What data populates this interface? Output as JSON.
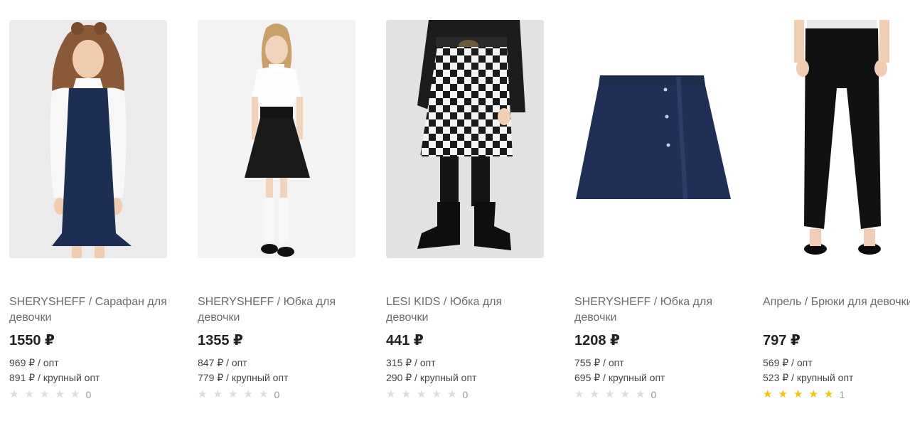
{
  "products": [
    {
      "title": "SHERYSHEFF / Сарафан для девочки",
      "price": "1550 ₽",
      "opt": "969 ₽ / опт",
      "bulk_opt": "891 ₽ / крупный опт",
      "rating_stars": 0,
      "reviews_count": "0"
    },
    {
      "title": "SHERYSHEFF / Юбка для девочки",
      "price": "1355 ₽",
      "opt": "847 ₽ / опт",
      "bulk_opt": "779 ₽ / крупный опт",
      "rating_stars": 0,
      "reviews_count": "0"
    },
    {
      "title": "LESI KIDS / Юбка для девочки",
      "price": "441 ₽",
      "opt": "315 ₽ / опт",
      "bulk_opt": "290 ₽ / крупный опт",
      "rating_stars": 0,
      "reviews_count": "0"
    },
    {
      "title": "SHERYSHEFF / Юбка для девочки",
      "price": "1208 ₽",
      "opt": "755 ₽ / опт",
      "bulk_opt": "695 ₽ / крупный опт",
      "rating_stars": 0,
      "reviews_count": "0"
    },
    {
      "title": "Апрель / Брюки для девочки",
      "price": "797 ₽",
      "opt": "569 ₽ / опт",
      "bulk_opt": "523 ₽ / крупный опт",
      "rating_stars": 5,
      "reviews_count": "1"
    }
  ],
  "colors": {
    "star_active": "#f5c400",
    "star_inactive": "#dcdcdc",
    "navy": "#1c2e52"
  }
}
